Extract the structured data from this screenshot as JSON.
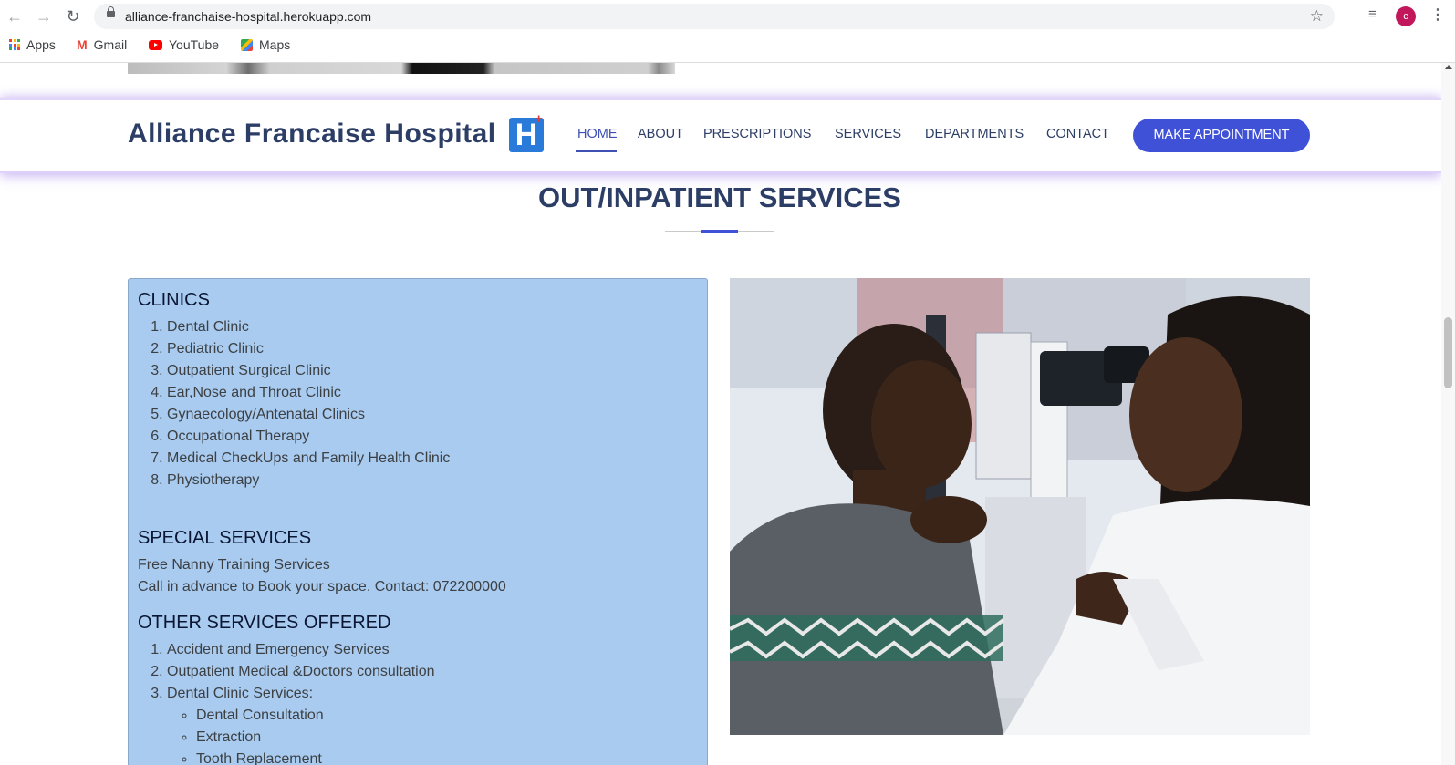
{
  "browser": {
    "url": "alliance-franchaise-hospital.herokuapp.com",
    "avatar_letter": "c",
    "bookmarks": [
      "Apps",
      "Gmail",
      "YouTube",
      "Maps"
    ]
  },
  "header": {
    "brand": "Alliance Francaise Hospital",
    "logo_letter": "H",
    "logo_plus": "+",
    "nav": [
      "HOME",
      "ABOUT",
      "PRESCRIPTIONS",
      "SERVICES",
      "DEPARTMENTS",
      "CONTACT"
    ],
    "active_nav": "HOME",
    "cta": "MAKE APPOINTMENT"
  },
  "section": {
    "title": "OUT/INPATIENT SERVICES"
  },
  "panel": {
    "clinics_heading": "CLINICS",
    "clinics": [
      "Dental Clinic",
      "Pediatric Clinic",
      "Outpatient Surgical Clinic",
      "Ear,Nose and Throat Clinic",
      "Gynaecology/Antenatal Clinics",
      "Occupational Therapy",
      "Medical CheckUps and Family Health Clinic",
      "Physiotherapy"
    ],
    "special_heading": "SPECIAL SERVICES",
    "special_lines": [
      "Free Nanny Training Services",
      "Call in advance to Book your space. Contact: 072200000"
    ],
    "other_heading": "OTHER SERVICES OFFERED",
    "other": [
      "Accident and Emergency Services",
      "Outpatient Medical &Doctors consultation",
      "Dental Clinic Services:"
    ],
    "dental_sub": [
      "Dental Consultation",
      "Extraction",
      "Tooth Replacement"
    ]
  },
  "colors": {
    "brand_navy": "#2c3e66",
    "accent": "#3f51d6",
    "panel_bg": "#a9cbf0"
  }
}
